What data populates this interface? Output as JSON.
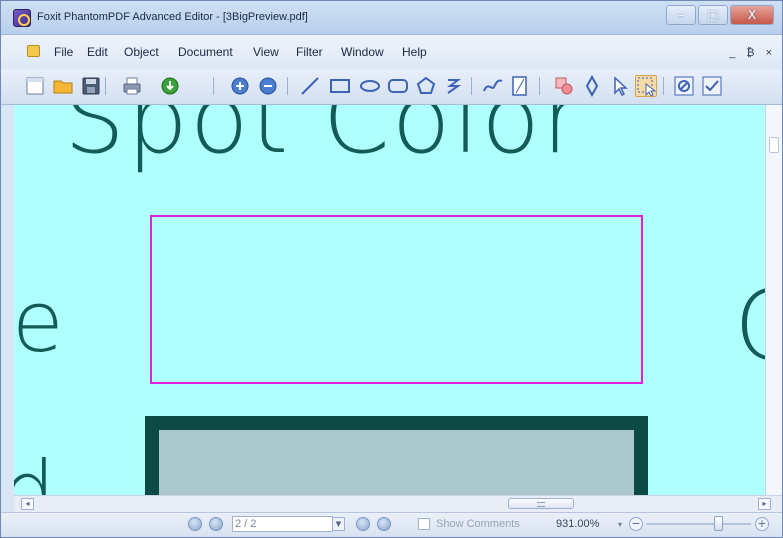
{
  "window": {
    "title": "Foxit PhantomPDF Advanced Editor - [3BigPreview.pdf]",
    "controls": [
      "–",
      "□",
      "X"
    ],
    "mdi_controls": "_ ₿ ×"
  },
  "menu": {
    "items": [
      "File",
      "Edit",
      "Object",
      "Document",
      "View",
      "Filter",
      "Window",
      "Help"
    ]
  },
  "toolbar": {
    "buttons": [
      "new-document-icon",
      "open-folder-icon",
      "save-icon",
      "print-icon",
      "export-icon",
      "zoom-in-icon",
      "zoom-out-icon",
      "line-tool-icon",
      "rectangle-tool-icon",
      "ellipse-tool-icon",
      "rounded-rectangle-tool-icon",
      "polygon-tool-icon",
      "text-path-icon",
      "curve-tool-icon",
      "page-tool-icon",
      "object-tool-icon",
      "move-tool-icon",
      "select-pointer-icon",
      "select-objects-icon",
      "hide-icon",
      "check-icon"
    ]
  },
  "canvas": {
    "background": "#afffff",
    "text_color": "#135b57",
    "heading_fragment": "Spot Color",
    "left_fragment_1": "e",
    "left_fragment_2": "d",
    "right_fragment": "C",
    "magenta_border_color": "#e31ce6",
    "dark_rect_border_color": "#0d4a45",
    "dark_rect_fill": "#aac8cd"
  },
  "scroll": {
    "left_arrow": "◂",
    "right_arrow": "▸"
  },
  "status": {
    "page_value": "2 / 2",
    "show_comments_label": "Show Comments",
    "zoom_value": "931.00%",
    "zoom_dropdown": "▾",
    "zoom_out": "−",
    "zoom_in": "+"
  }
}
